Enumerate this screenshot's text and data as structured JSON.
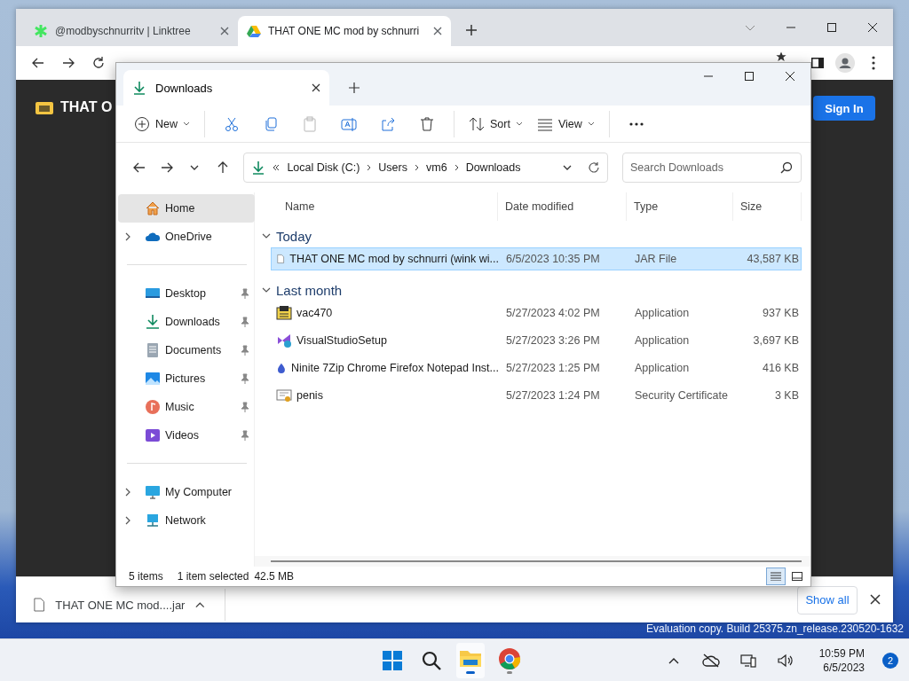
{
  "browser": {
    "tabs": [
      {
        "title": "@modbyschnurritv | Linktree",
        "kind": "linktree",
        "selected": false
      },
      {
        "title": "THAT ONE MC mod by schnurri",
        "kind": "drive",
        "selected": true
      }
    ],
    "page": {
      "heading": "THAT O",
      "sign_in": "Sign In"
    },
    "download_bar": {
      "file": "THAT ONE MC mod....jar",
      "show_all": "Show all"
    }
  },
  "explorer": {
    "tab": "Downloads",
    "toolbar": [
      {
        "kind": "new",
        "label": "New",
        "disabled": false
      },
      {
        "kind": "cut",
        "disabled": false
      },
      {
        "kind": "copy",
        "disabled": false
      },
      {
        "kind": "paste",
        "disabled": true
      },
      {
        "kind": "rename",
        "disabled": false
      },
      {
        "kind": "share",
        "disabled": false
      },
      {
        "kind": "delete",
        "disabled": false
      },
      {
        "kind": "sort",
        "label": "Sort",
        "disabled": false
      },
      {
        "kind": "view",
        "label": "View",
        "disabled": false
      },
      {
        "kind": "more",
        "disabled": false
      }
    ],
    "breadcrumb": [
      "Local Disk (C:)",
      "Users",
      "vm6",
      "Downloads"
    ],
    "search": {
      "placeholder": "Search Downloads"
    },
    "nav": [
      {
        "items": [
          {
            "label": "Home",
            "kind": "home",
            "selected": true,
            "expandable": false,
            "pinned": false
          },
          {
            "label": "OneDrive",
            "kind": "cloud",
            "selected": false,
            "expandable": true,
            "pinned": false
          }
        ]
      },
      {
        "items": [
          {
            "label": "Desktop",
            "kind": "desktop",
            "selected": false,
            "expandable": false,
            "pinned": true
          },
          {
            "label": "Downloads",
            "kind": "downloads",
            "selected": false,
            "expandable": false,
            "pinned": true
          },
          {
            "label": "Documents",
            "kind": "documents",
            "selected": false,
            "expandable": false,
            "pinned": true
          },
          {
            "label": "Pictures",
            "kind": "pictures",
            "selected": false,
            "expandable": false,
            "pinned": true
          },
          {
            "label": "Music",
            "kind": "music",
            "selected": false,
            "expandable": false,
            "pinned": true
          },
          {
            "label": "Videos",
            "kind": "videos",
            "selected": false,
            "expandable": false,
            "pinned": true
          }
        ]
      },
      {
        "items": [
          {
            "label": "My Computer",
            "kind": "computer",
            "selected": false,
            "expandable": true,
            "pinned": false
          },
          {
            "label": "Network",
            "kind": "network",
            "selected": false,
            "expandable": true,
            "pinned": false
          }
        ]
      }
    ],
    "columns": [
      "Name",
      "Date modified",
      "Type",
      "Size"
    ],
    "groups": [
      {
        "label": "Today",
        "expanded": true,
        "rows": [
          {
            "name": "THAT ONE MC mod by schnurri (wink wi...",
            "date": "6/5/2023 10:35 PM",
            "type": "JAR File",
            "size": "43,587 KB",
            "kind": "file",
            "selected": true
          }
        ]
      },
      {
        "label": "Last month",
        "expanded": true,
        "rows": [
          {
            "name": "vac470",
            "date": "5/27/2023 4:02 PM",
            "type": "Application",
            "size": "937 KB",
            "kind": "setup",
            "selected": false
          },
          {
            "name": "VisualStudioSetup",
            "date": "5/27/2023 3:26 PM",
            "type": "Application",
            "size": "3,697 KB",
            "kind": "studio",
            "selected": false
          },
          {
            "name": "Ninite 7Zip Chrome Firefox Notepad Inst...",
            "date": "5/27/2023 1:25 PM",
            "type": "Application",
            "size": "416 KB",
            "kind": "ninite",
            "selected": false
          },
          {
            "name": "penis",
            "date": "5/27/2023 1:24 PM",
            "type": "Security Certificate",
            "size": "3 KB",
            "kind": "certificate",
            "selected": false
          }
        ]
      }
    ],
    "status": {
      "count": "5 items",
      "selection": "1 item selected",
      "size": "42.5 MB"
    }
  },
  "watermark": "Evaluation copy. Build 25375.zn_release.230520-1632",
  "taskbar": {
    "time": "10:59 PM",
    "date": "6/5/2023",
    "notifications": "2"
  }
}
